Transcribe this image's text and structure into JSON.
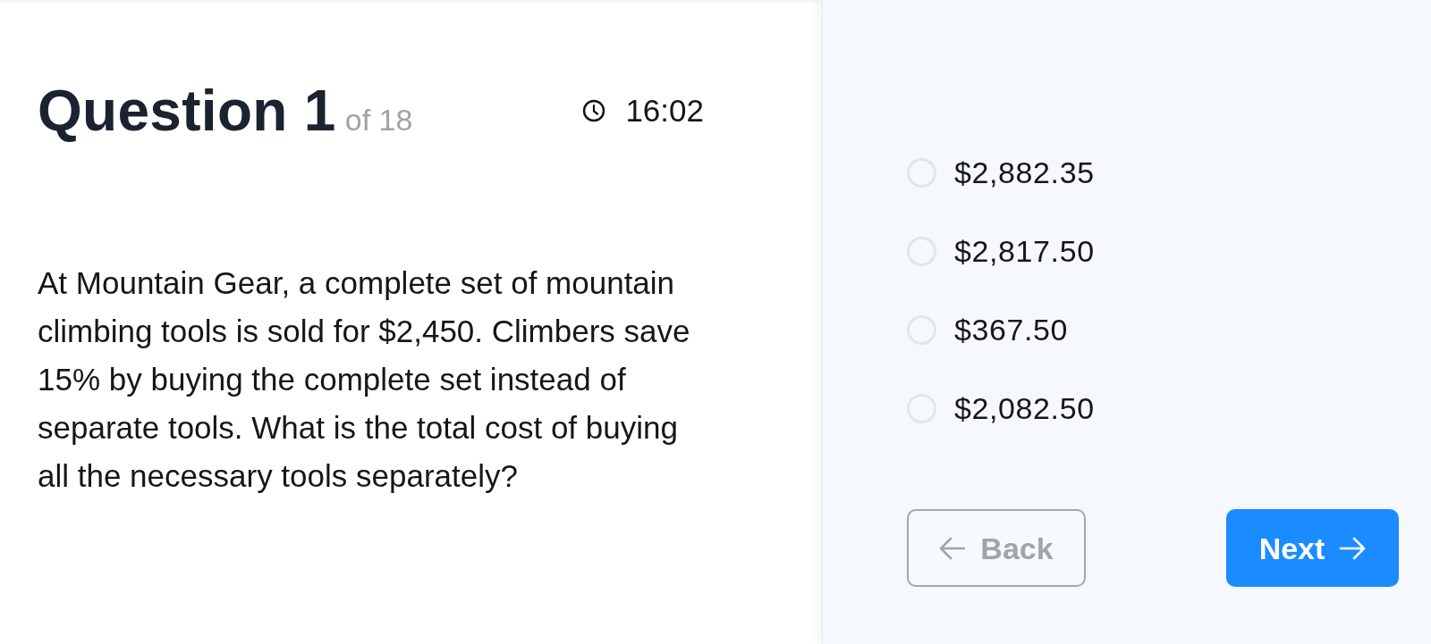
{
  "question": {
    "title": "Question 1",
    "count": "of 18",
    "timer": "16:02",
    "text": "At Mountain Gear, a complete set of mountain climbing tools is sold for $2,450. Climbers save 15% by buying the complete set instead of separate tools. What is the total cost of buying all the necessary tools separately?"
  },
  "options": [
    {
      "label": "$2,882.35",
      "selected": false
    },
    {
      "label": "$2,817.50",
      "selected": false
    },
    {
      "label": "$367.50",
      "selected": false
    },
    {
      "label": "$2,082.50",
      "selected": false
    }
  ],
  "buttons": [
    {
      "kind": "back",
      "label": "Back",
      "disabled": true
    },
    {
      "kind": "next",
      "label": "Next",
      "disabled": false
    }
  ]
}
